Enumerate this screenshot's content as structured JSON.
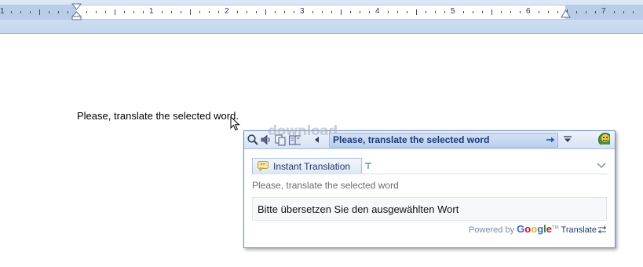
{
  "ruler": {
    "numbers": [
      "1",
      "1",
      "2",
      "3",
      "4",
      "5",
      "6",
      "7"
    ]
  },
  "document": {
    "text": "Please, translate the selected word."
  },
  "popup": {
    "watermark": "download",
    "title": "Please, translate the selected word",
    "tab_label": "Instant Translation",
    "source_text": "Please, translate the selected word",
    "translation": "Bitte übersetzen Sie den ausgewählten Wort",
    "powered_by": "Powered by",
    "google_letters": [
      "G",
      "o",
      "o",
      "g",
      "l",
      "e"
    ],
    "tm": "TM",
    "translate_label": "Translate",
    "google_colors": [
      "#3369e8",
      "#d50f25",
      "#eeb211",
      "#3369e8",
      "#009925",
      "#d50f25"
    ]
  }
}
